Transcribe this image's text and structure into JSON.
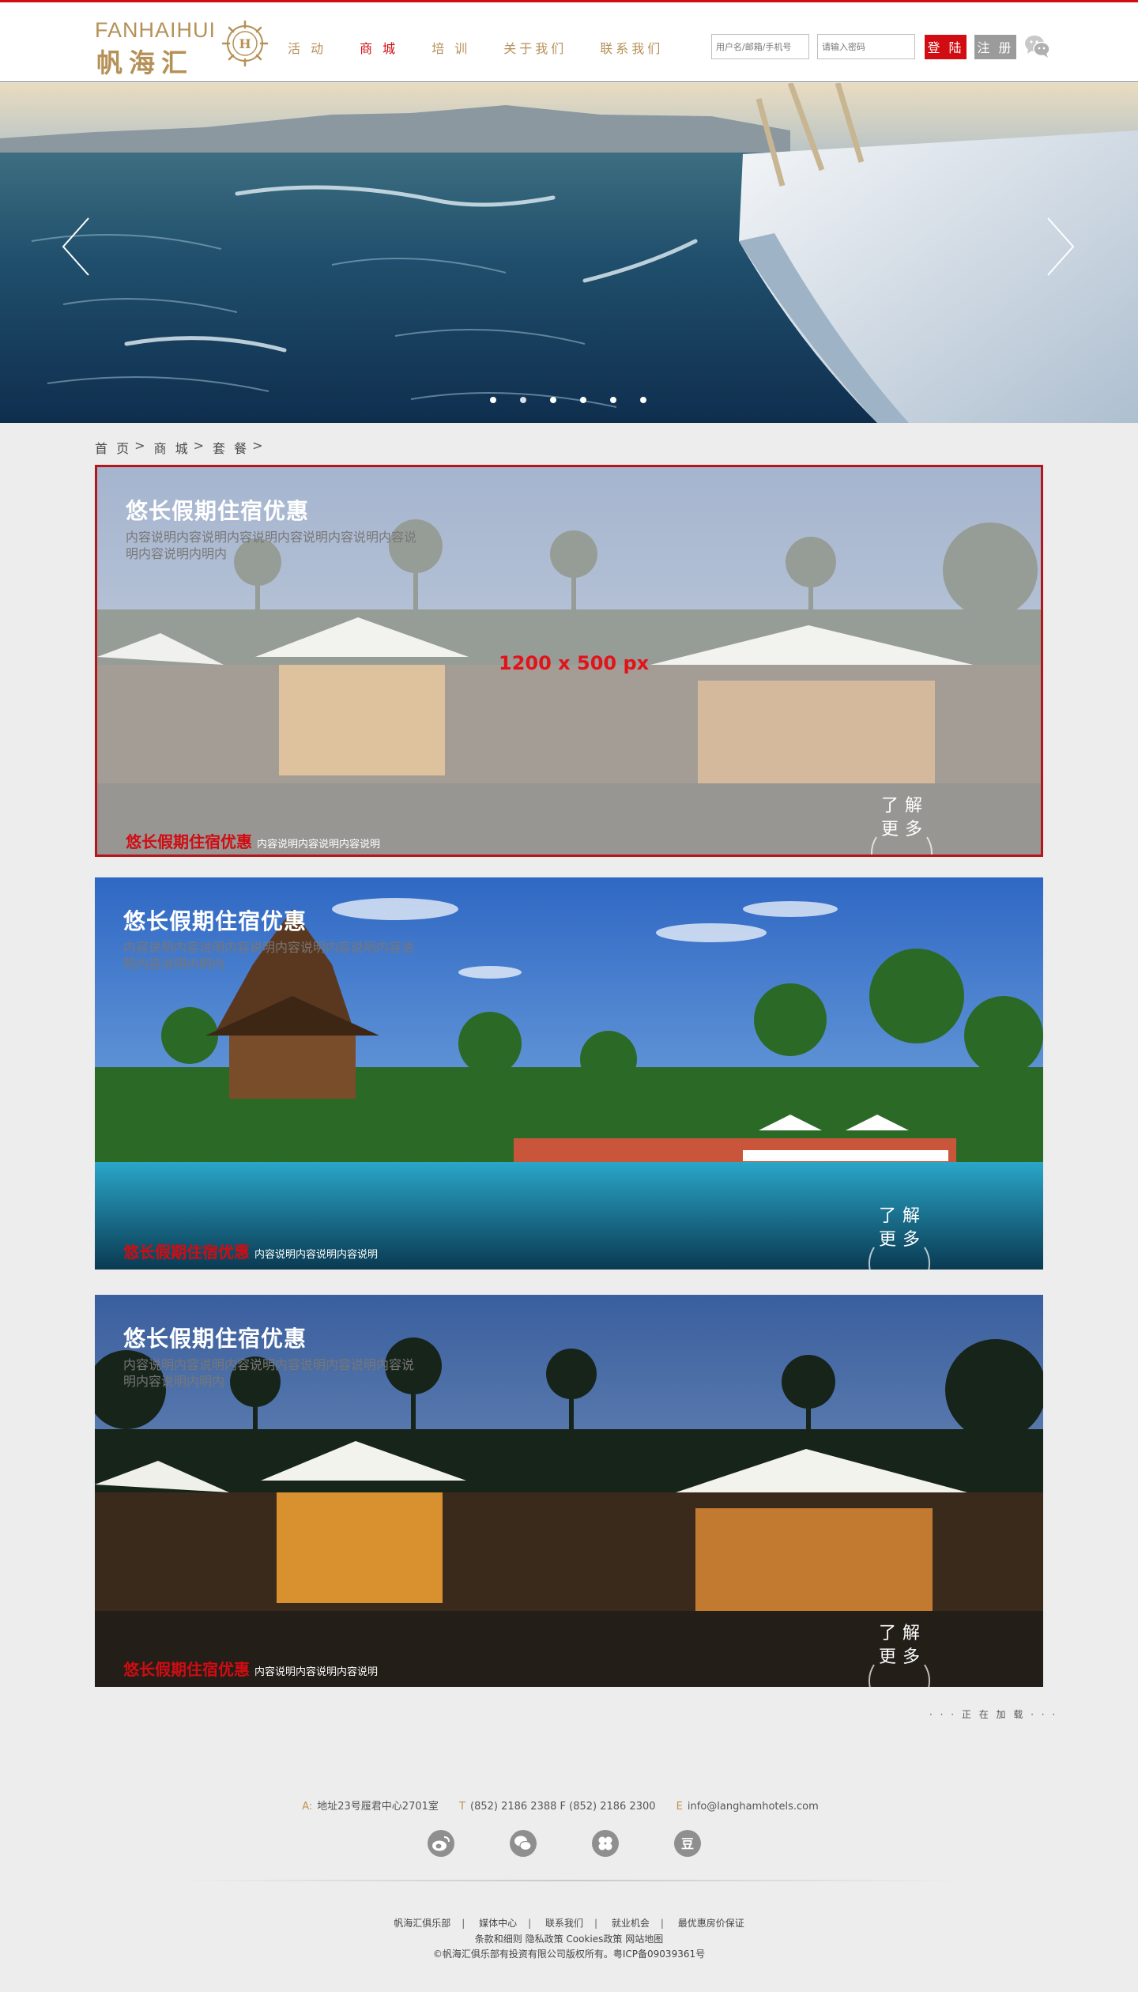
{
  "header": {
    "logo_en": "FANHAIHUI",
    "logo_cn": "帆海汇",
    "nav": [
      "活 动",
      "商 城",
      "培 训",
      "关于我们",
      "联系我们"
    ],
    "active_nav": 1,
    "login": {
      "user_placeholder": "用户名/邮箱/手机号",
      "password_placeholder": "请输入密码",
      "login_label": "登 陆",
      "register_label": "注 册"
    }
  },
  "hero": {
    "slide_count": 6,
    "active_slide": 1
  },
  "breadcrumb": {
    "items": [
      "首 页",
      "商 城",
      "套 餐"
    ],
    "separator": ">"
  },
  "cards": [
    {
      "title": "悠长假期住宿优惠",
      "description": "内容说明内容说明内容说明内容说明内容说明内容说明内容说明内明内",
      "footer_title": "悠长假期住宿优惠",
      "footer_desc": "内容说明内容说明内容说明",
      "more_line1": "了解",
      "more_line2": "更多",
      "placeholder_size": "1200 x 500 px"
    },
    {
      "title": "悠长假期住宿优惠",
      "description": "内容说明内容说明内容说明内容说明内容说明内容说明内容说明内明内",
      "footer_title": "悠长假期住宿优惠",
      "footer_desc": "内容说明内容说明内容说明",
      "more_line1": "了解",
      "more_line2": "更多"
    },
    {
      "title": "悠长假期住宿优惠",
      "description": "内容说明内容说明内容说明内容说明内容说明内容说明内容说明内明内",
      "footer_title": "悠长假期住宿优惠",
      "footer_desc": "内容说明内容说明内容说明",
      "more_line1": "了解",
      "more_line2": "更多"
    }
  ],
  "loading_text": "· · · 正 在 加 载 · · ·",
  "footer": {
    "address_key": "A:",
    "address": "地址23号履君中心2701室",
    "tel_key": "T",
    "tel": "(852) 2186 2388 F (852) 2186 2300",
    "email_key": "E",
    "email": "info@langhamhotels.com",
    "socials": [
      "weibo-icon",
      "wechat-icon",
      "clover-icon",
      "douban-icon"
    ],
    "links": [
      "帆海汇俱乐部",
      "媒体中心",
      "联系我们",
      "就业机会",
      "最优惠房价保证"
    ],
    "policy": "条款和细则 隐私政策 Cookies政策 网站地图",
    "copyright": "©帆海汇俱乐部有投资有限公司版权所有。粤ICP备09039361号"
  },
  "colors": {
    "accent_red": "#d10c12",
    "gold": "#b59158",
    "background": "#ededed"
  }
}
